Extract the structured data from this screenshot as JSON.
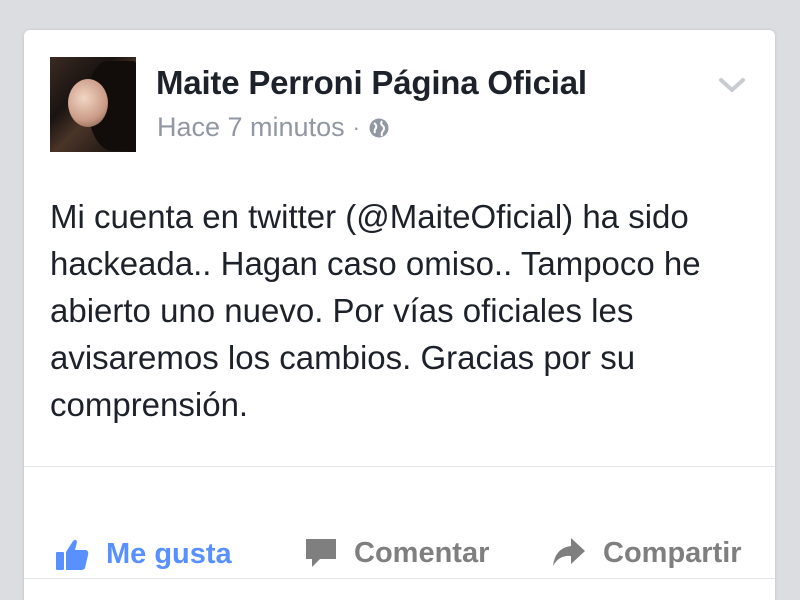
{
  "post": {
    "author": "Maite Perroni Página Oficial",
    "timestamp": "Hace 7 minutos",
    "separator": "·",
    "privacy_icon": "globe-icon",
    "text": "Mi cuenta en twitter (@MaiteOficial) ha sido hackeada.. Hagan caso omiso.. Tampoco he abierto uno nuevo. Por vías oficiales les avisaremos los cambios. Gracias por su comprensión."
  },
  "actions": {
    "like_label": "Me gusta",
    "comment_label": "Comentar",
    "share_label": "Compartir"
  },
  "colors": {
    "like_accent": "#5890ff",
    "text_primary": "#1d2129",
    "text_secondary": "#9197a3",
    "action_gray": "#7f7f7f"
  }
}
